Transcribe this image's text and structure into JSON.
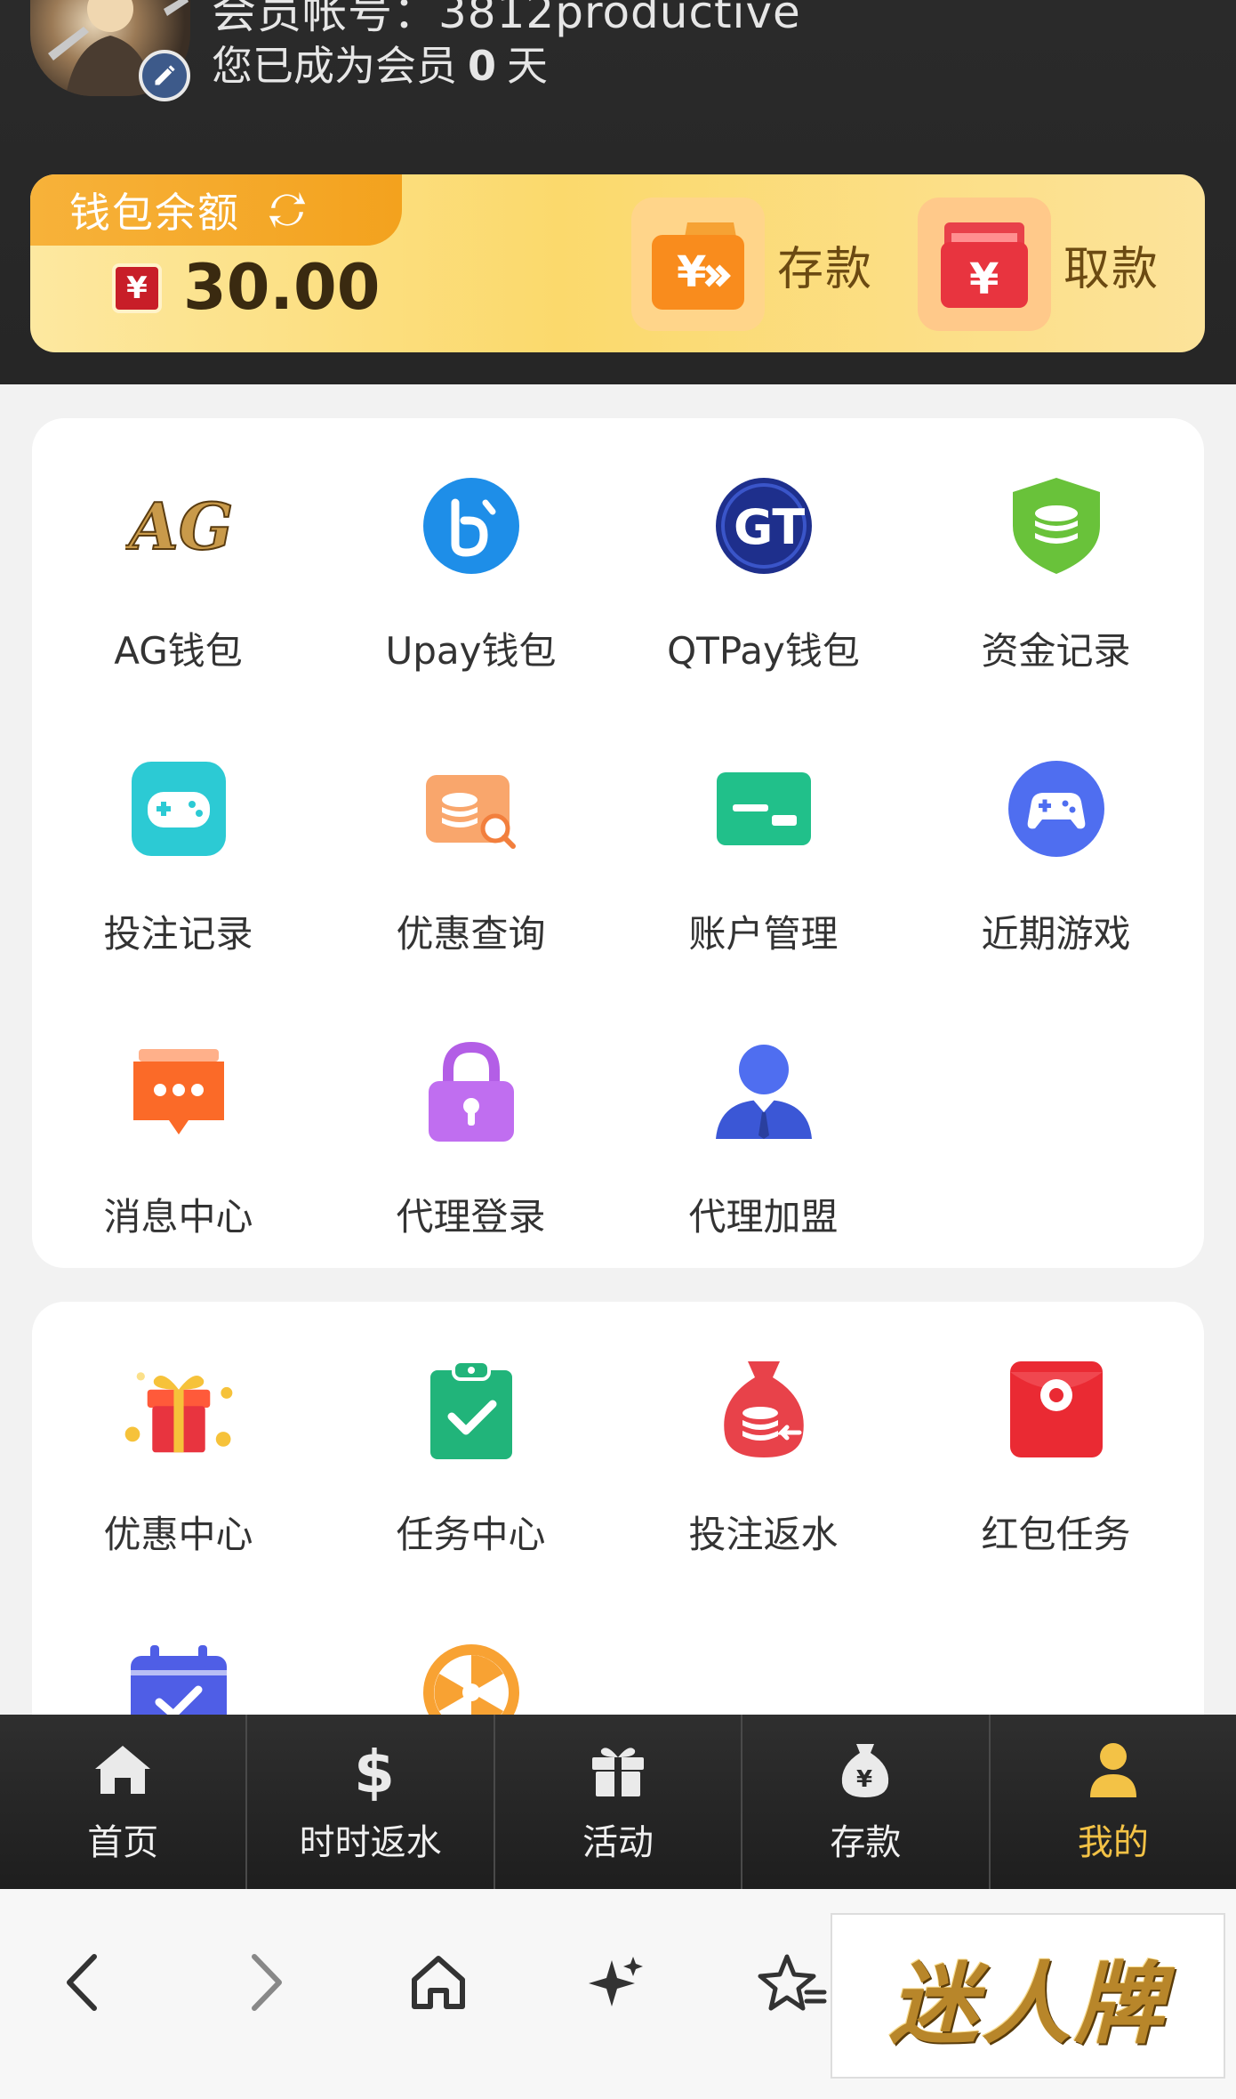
{
  "header": {
    "account_text": "会员帐号：3812productive",
    "member_prefix": "您已成为会员",
    "member_days": "0",
    "member_suffix": "天"
  },
  "wallet": {
    "label": "钱包余额",
    "currency_symbol": "¥",
    "balance": "30.00",
    "deposit_label": "存款",
    "withdraw_label": "取款"
  },
  "menu1": [
    {
      "label": "AG钱包",
      "icon": "ag-logo-icon"
    },
    {
      "label": "Upay钱包",
      "icon": "upay-logo-icon"
    },
    {
      "label": "QTPay钱包",
      "icon": "qtpay-logo-icon"
    },
    {
      "label": "资金记录",
      "icon": "shield-coins-icon"
    },
    {
      "label": "投注记录",
      "icon": "gamepad-icon"
    },
    {
      "label": "优惠查询",
      "icon": "coupon-search-icon"
    },
    {
      "label": "账户管理",
      "icon": "card-icon"
    },
    {
      "label": "近期游戏",
      "icon": "controller-icon"
    },
    {
      "label": "消息中心",
      "icon": "chat-bubble-icon"
    },
    {
      "label": "代理登录",
      "icon": "lock-icon"
    },
    {
      "label": "代理加盟",
      "icon": "agent-person-icon"
    }
  ],
  "menu2": [
    {
      "label": "优惠中心",
      "icon": "gift-box-icon"
    },
    {
      "label": "任务中心",
      "icon": "clipboard-check-icon"
    },
    {
      "label": "投注返水",
      "icon": "money-bag-icon"
    },
    {
      "label": "红包任务",
      "icon": "red-envelope-icon"
    },
    {
      "label": "",
      "icon": "calendar-check-icon"
    },
    {
      "label": "",
      "icon": "wheel-icon"
    }
  ],
  "nav": [
    {
      "label": "首页",
      "icon": "home-icon"
    },
    {
      "label": "时时返水",
      "icon": "dollar-icon"
    },
    {
      "label": "活动",
      "icon": "gift-icon"
    },
    {
      "label": "存款",
      "icon": "yen-bag-icon"
    },
    {
      "label": "我的",
      "icon": "user-icon",
      "active": true
    }
  ],
  "browser": {
    "watermark": "迷人牌"
  },
  "colors": {
    "header_bg": "#262626",
    "wallet_gold": "#fbd96c",
    "active_nav": "#f3c246"
  }
}
